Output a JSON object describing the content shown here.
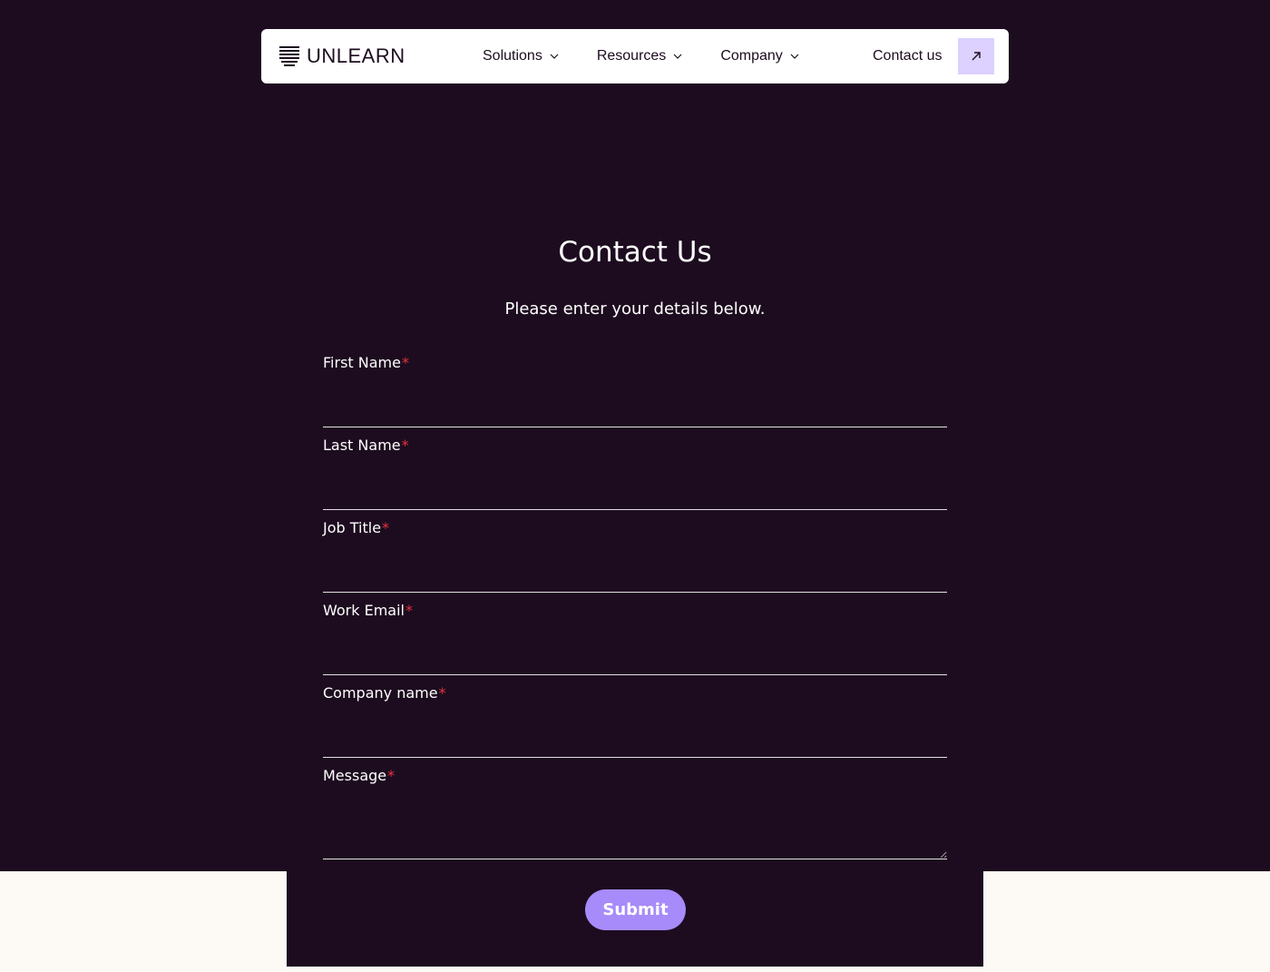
{
  "brand": {
    "name": "UNLEARN"
  },
  "nav": {
    "items": [
      {
        "label": "Solutions"
      },
      {
        "label": "Resources"
      },
      {
        "label": "Company"
      }
    ],
    "contact_label": "Contact us"
  },
  "page": {
    "title": "Contact Us",
    "subtitle": "Please enter your details below."
  },
  "form": {
    "required_marker": "*",
    "fields": [
      {
        "label": "First Name",
        "value": "",
        "placeholder": ""
      },
      {
        "label": "Last Name",
        "value": "",
        "placeholder": ""
      },
      {
        "label": "Job Title",
        "value": "",
        "placeholder": ""
      },
      {
        "label": "Work Email",
        "value": "",
        "placeholder": ""
      },
      {
        "label": "Company name",
        "value": "",
        "placeholder": ""
      },
      {
        "label": "Message",
        "value": "",
        "placeholder": ""
      }
    ],
    "submit_label": "Submit"
  },
  "colors": {
    "background_dark": "#1d0c1f",
    "background_light": "#fdf9f5",
    "accent": "#a78bfa",
    "accent_light": "#dcd1ff",
    "required": "#e8323c"
  },
  "icons": {
    "logo": "unlearn-logo-icon",
    "dropdown": "chevron-down-icon",
    "external": "arrow-up-right-icon"
  }
}
